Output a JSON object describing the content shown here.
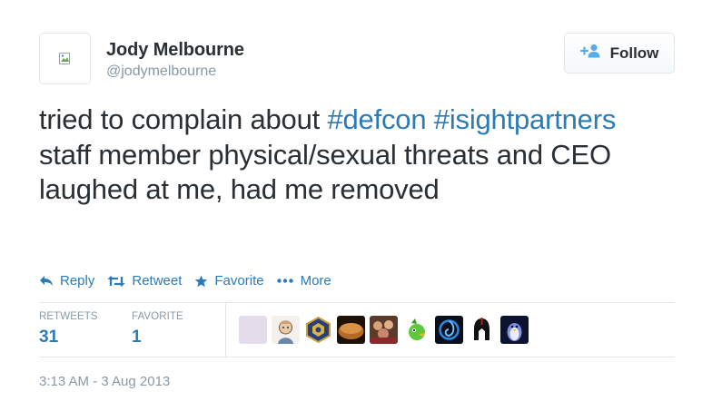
{
  "author": {
    "name": "Jody Melbourne",
    "handle": "@jodymelbourne",
    "avatar_icon": "broken-image-icon"
  },
  "follow_button": {
    "label": "Follow",
    "icon": "add-user-icon"
  },
  "tweet": {
    "segments": [
      {
        "text": "tried to complain about ",
        "type": "text"
      },
      {
        "text": "#defcon",
        "type": "hashtag"
      },
      {
        "text": " ",
        "type": "text"
      },
      {
        "text": "#isightpartners",
        "type": "hashtag"
      },
      {
        "text": " staff member physical/sexual threats and CEO laughed at me, had me removed",
        "type": "text"
      }
    ]
  },
  "actions": [
    {
      "label": "Reply",
      "icon": "reply-icon"
    },
    {
      "label": "Retweet",
      "icon": "retweet-icon"
    },
    {
      "label": "Favorite",
      "icon": "star-icon"
    },
    {
      "label": "More",
      "icon": "more-dots-icon"
    }
  ],
  "stats": {
    "retweets_label": "RETWEETS",
    "retweets_value": "31",
    "favorites_label": "FAVORITE",
    "favorites_value": "1"
  },
  "faces": [
    {
      "name": "favoriter-avatar-1",
      "icon": "blank-avatar"
    },
    {
      "name": "favoriter-avatar-2",
      "icon": "face-portrait"
    },
    {
      "name": "favoriter-avatar-3",
      "icon": "badge-emblem"
    },
    {
      "name": "favoriter-avatar-4",
      "icon": "bread-photo"
    },
    {
      "name": "favoriter-avatar-5",
      "icon": "group-photo"
    },
    {
      "name": "favoriter-avatar-6",
      "icon": "green-character"
    },
    {
      "name": "favoriter-avatar-7",
      "icon": "blue-swirl"
    },
    {
      "name": "favoriter-avatar-8",
      "icon": "helmet-silhouette"
    },
    {
      "name": "favoriter-avatar-9",
      "icon": "penguin"
    }
  ],
  "timestamp": "3:13 AM - 3 Aug 2013",
  "colors": {
    "link": "#2b7bb9",
    "text": "#292f33",
    "muted": "#8899a6",
    "border": "#e1e8ed"
  }
}
